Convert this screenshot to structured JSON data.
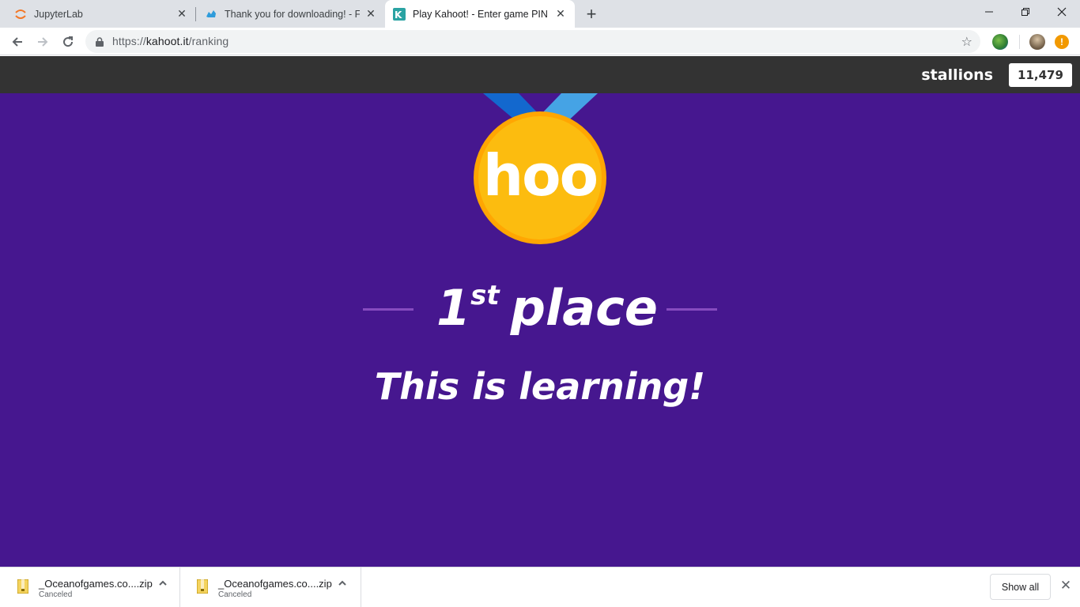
{
  "browser": {
    "tabs": [
      {
        "title": "JupyterLab",
        "favicon": "jupyter-icon",
        "active": false
      },
      {
        "title": "Thank you for downloading! - FileHorse",
        "favicon": "filehorse-icon",
        "active": false
      },
      {
        "title": "Play Kahoot! - Enter game PIN here!",
        "favicon": "kahoot-icon",
        "active": true
      }
    ],
    "new_tab_label": "+",
    "url": {
      "scheme": "https://",
      "host": "kahoot.it",
      "path": "/ranking"
    }
  },
  "game": {
    "nickname": "stallions",
    "score": "11,479",
    "medal_text": "hoo",
    "rank_number": "1",
    "rank_suffix": "st",
    "rank_word": "place",
    "message": "This is learning!"
  },
  "downloads": {
    "items": [
      {
        "name": "_Oceanofgames.co....zip",
        "status": "Canceled"
      },
      {
        "name": "_Oceanofgames.co....zip",
        "status": "Canceled"
      }
    ],
    "show_all_label": "Show all"
  },
  "colors": {
    "page_background": "#46178f",
    "header_bar": "#333333",
    "medal_gold": "#fcbc0f",
    "medal_rim": "#ffa602",
    "ribbon_dark": "#1368ce",
    "ribbon_light": "#45a3e5",
    "rank_line": "#864cbf"
  }
}
